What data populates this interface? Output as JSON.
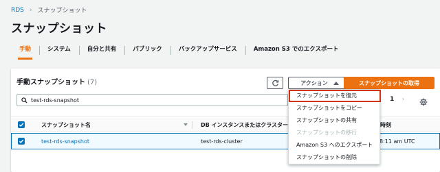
{
  "breadcrumb": {
    "root": "RDS",
    "current": "スナップショット"
  },
  "page_title": "スナップショット",
  "tabs": [
    {
      "label": "手動",
      "active": true
    },
    {
      "label": "システム",
      "active": false
    },
    {
      "label": "自分と共有",
      "active": false
    },
    {
      "label": "パブリック",
      "active": false
    },
    {
      "label": "バックアップサービス",
      "active": false
    },
    {
      "label": "Amazon S3 でのエクスポート",
      "active": false
    }
  ],
  "panel": {
    "title": "手動スナップショット",
    "count": "(7)",
    "actions_label": "アクション",
    "take_snapshot_label": "スナップショットの取得",
    "search_value": "test-rds-snapshot",
    "page_number": "1"
  },
  "table": {
    "columns": [
      "スナップショット名",
      "DB インスタンスまたはクラスター",
      "時刻"
    ],
    "rows": [
      {
        "name": "test-rds-snapshot",
        "db": "test-rds-cluster",
        "time": "8:11 am UTC",
        "selected": true
      }
    ]
  },
  "action_menu": {
    "items": [
      {
        "label": "スナップショットを復元",
        "highlighted": true,
        "disabled": false
      },
      {
        "label": "スナップショットをコピー",
        "highlighted": false,
        "disabled": false
      },
      {
        "label": "スナップショットの共有",
        "highlighted": false,
        "disabled": false
      },
      {
        "label": "スナップショットの移行",
        "highlighted": false,
        "disabled": true
      },
      {
        "label": "Amazon S3 へのエクスポート",
        "highlighted": false,
        "disabled": false
      },
      {
        "label": "スナップショットの削除",
        "highlighted": false,
        "disabled": false
      }
    ]
  },
  "colors": {
    "accent": "#ec7211",
    "link": "#0073bb",
    "highlight_border": "#d13212"
  }
}
